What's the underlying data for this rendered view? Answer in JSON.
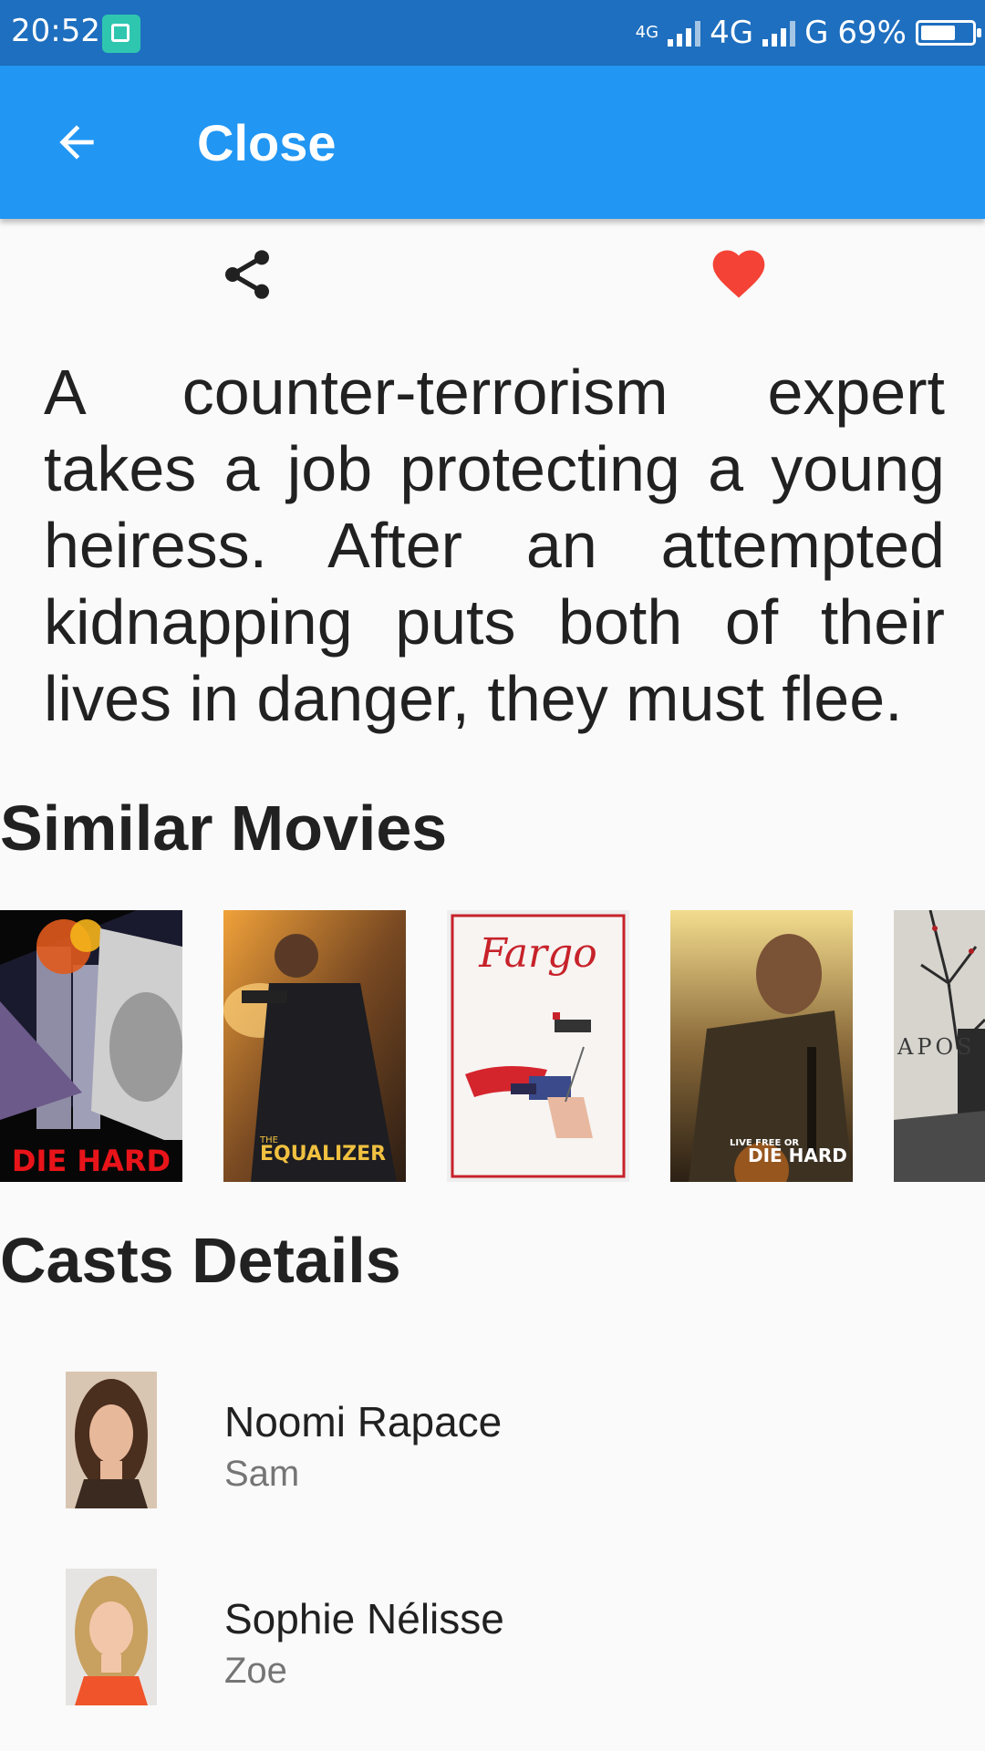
{
  "status_bar": {
    "time": "20:52",
    "network_1_small": "4G",
    "network_2": "4G",
    "network_3": "G",
    "battery": "69%",
    "battery_level": 0.69
  },
  "app_bar": {
    "back_icon": "arrow-left-icon",
    "title": "Close"
  },
  "actions": {
    "share_icon": "share-icon",
    "favorite_icon": "heart-icon",
    "favorite_color": "#f44336"
  },
  "overview": "A counter-terrorism expert takes a job protecting a young heiress. After an attempted kidnapping puts both of their lives in danger, they must flee.",
  "similar": {
    "title": "Similar Movies",
    "posters": [
      {
        "title": "DIE HARD"
      },
      {
        "title": "EQUALIZER",
        "title_small": "THE"
      },
      {
        "title": "Fargo"
      },
      {
        "title": "DIE HARD",
        "title_small": "LIVE FREE OR"
      },
      {
        "title": "APOS"
      }
    ]
  },
  "casts": {
    "title": "Casts Details",
    "items": [
      {
        "name": "Noomi Rapace",
        "character": "Sam"
      },
      {
        "name": "Sophie Nélisse",
        "character": "Zoe"
      }
    ]
  },
  "colors": {
    "status_bar": "#1e6fbf",
    "app_bar": "#2196f3",
    "background": "#fafafa"
  }
}
